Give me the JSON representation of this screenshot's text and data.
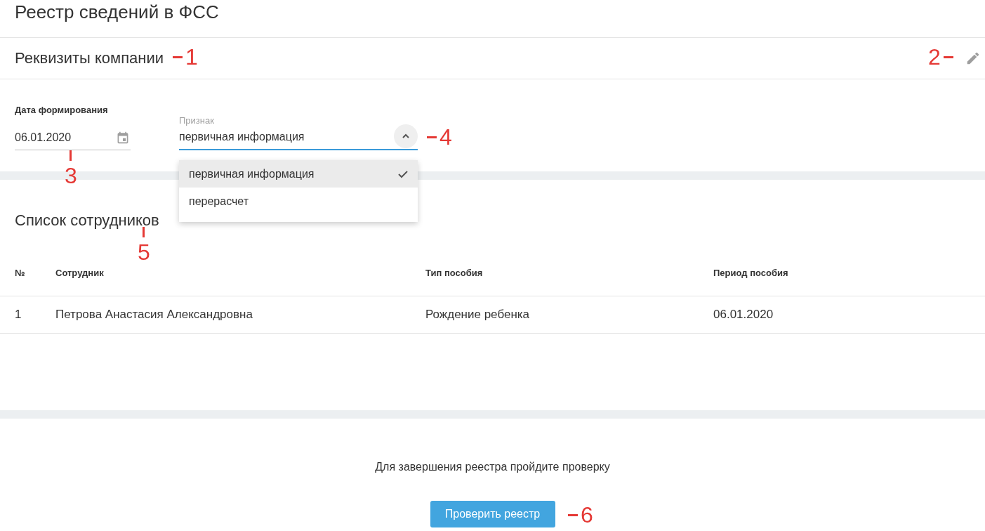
{
  "page": {
    "title": "Реестр сведений в ФСС"
  },
  "company_section": {
    "title": "Реквизиты компании"
  },
  "form": {
    "date_field": {
      "label": "Дата формирования",
      "value": "06.01.2020"
    },
    "type_select": {
      "label": "Признак",
      "value": "первичная информация",
      "expanded": true,
      "options": [
        {
          "label": "первичная информация",
          "selected": true
        },
        {
          "label": "перерасчет",
          "selected": false
        }
      ]
    }
  },
  "employees": {
    "title": "Список сотрудников",
    "columns": [
      "№",
      "Сотрудник",
      "Тип пособия",
      "Период пособия"
    ],
    "rows": [
      [
        "1",
        "Петрова Анастасия Александровна",
        "Рождение ребенка",
        "06.01.2020"
      ]
    ]
  },
  "footer": {
    "message": "Для завершения реестра пройдите проверку",
    "button": "Проверить реестр"
  },
  "annotations": [
    {
      "label": "1",
      "kind": "dash-before"
    },
    {
      "label": "2",
      "kind": "dash-after"
    },
    {
      "label": "3",
      "kind": "tick-above"
    },
    {
      "label": "4",
      "kind": "dash-before"
    },
    {
      "label": "5",
      "kind": "tick-above"
    },
    {
      "label": "6",
      "kind": "dash-before"
    }
  ]
}
